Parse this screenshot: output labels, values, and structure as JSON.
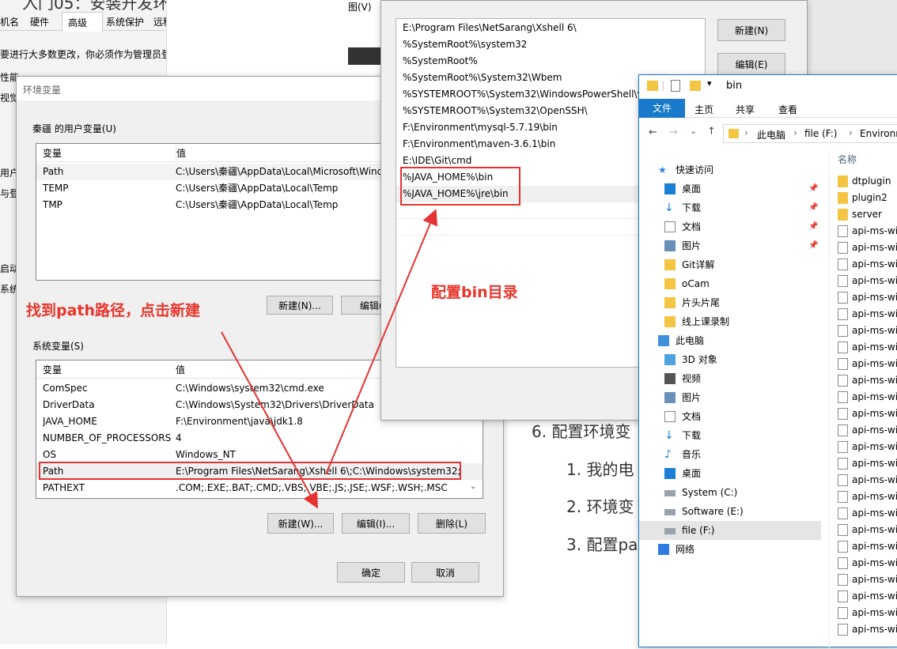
{
  "bg": {
    "title_fragment": "入门05：安装开发环境",
    "sys_tabs": [
      "机名",
      "硬件",
      "高级",
      "系统保护",
      "远程"
    ],
    "admin_note": "要进行大多数更改，你必须作为管理员登录。",
    "side_frags": [
      "性能",
      "视觉",
      "用户配",
      "与登",
      "启动",
      "系统"
    ],
    "menu_frag": "图(V)",
    "article": {
      "heading": "6. 配置环境变",
      "items": [
        "1. 我的电",
        "2. 环境变",
        "3. 配置pa"
      ]
    }
  },
  "env": {
    "title": "环境变量",
    "user_section": "秦疆 的用户变量(U)",
    "col_var": "变量",
    "col_val": "值",
    "user_vars": [
      {
        "name": "Path",
        "value": "C:\\Users\\秦疆\\AppData\\Local\\Microsoft\\Wind"
      },
      {
        "name": "TEMP",
        "value": "C:\\Users\\秦疆\\AppData\\Local\\Temp"
      },
      {
        "name": "TMP",
        "value": "C:\\Users\\秦疆\\AppData\\Local\\Temp"
      }
    ],
    "user_new": "新建(N)...",
    "user_edit": "编辑(E",
    "sys_section": "系统变量(S)",
    "sys_vars": [
      {
        "name": "ComSpec",
        "value": "C:\\Windows\\system32\\cmd.exe"
      },
      {
        "name": "DriverData",
        "value": "C:\\Windows\\System32\\Drivers\\DriverData"
      },
      {
        "name": "JAVA_HOME",
        "value": "F:\\Environment\\java\\jdk1.8"
      },
      {
        "name": "NUMBER_OF_PROCESSORS",
        "value": "4"
      },
      {
        "name": "OS",
        "value": "Windows_NT"
      },
      {
        "name": "Path",
        "value": "E:\\Program Files\\NetSarang\\Xshell 6\\;C:\\Windows\\system32;..."
      },
      {
        "name": "PATHEXT",
        "value": ".COM;.EXE;.BAT;.CMD;.VBS;.VBE;.JS;.JSE;.WSF;.WSH;.MSC"
      }
    ],
    "sys_new": "新建(W)...",
    "sys_edit": "编辑(I)...",
    "sys_delete": "删除(L)",
    "ok": "确定",
    "cancel": "取消"
  },
  "path_editor": {
    "entries": [
      "E:\\Program Files\\NetSarang\\Xshell 6\\",
      "%SystemRoot%\\system32",
      "%SystemRoot%",
      "%SystemRoot%\\System32\\Wbem",
      "%SYSTEMROOT%\\System32\\WindowsPowerShell\\v1",
      "%SYSTEMROOT%\\System32\\OpenSSH\\",
      "F:\\Environment\\mysql-5.7.19\\bin",
      "F:\\Environment\\maven-3.6.1\\bin",
      "E:\\IDE\\Git\\cmd",
      "%JAVA_HOME%\\bin",
      "%JAVA_HOME%\\jre\\bin"
    ],
    "new_btn": "新建(N)",
    "edit_btn": "编辑(E)"
  },
  "explorer": {
    "title": "bin",
    "ribbon_tabs": [
      "文件",
      "主页",
      "共享",
      "查看"
    ],
    "breadcrumb": [
      "此电脑",
      "file (F:)",
      "Environm"
    ],
    "column_header": "名称",
    "nav": [
      {
        "label": "快速访问",
        "icon": "star-icon",
        "pinned": false,
        "level": 0
      },
      {
        "label": "桌面",
        "icon": "desktop-icon",
        "pinned": true,
        "level": 1
      },
      {
        "label": "下载",
        "icon": "download-icon",
        "pinned": true,
        "level": 1
      },
      {
        "label": "文档",
        "icon": "document-icon",
        "pinned": true,
        "level": 1
      },
      {
        "label": "图片",
        "icon": "picture-icon",
        "pinned": true,
        "level": 1
      },
      {
        "label": "Git详解",
        "icon": "folder-icon",
        "pinned": false,
        "level": 1
      },
      {
        "label": "oCam",
        "icon": "folder-icon",
        "pinned": false,
        "level": 1
      },
      {
        "label": "片头片尾",
        "icon": "folder-icon",
        "pinned": false,
        "level": 1
      },
      {
        "label": "线上课录制",
        "icon": "folder-icon",
        "pinned": false,
        "level": 1
      },
      {
        "label": "此电脑",
        "icon": "computer-icon",
        "pinned": false,
        "level": 0
      },
      {
        "label": "3D 对象",
        "icon": "cube-icon",
        "pinned": false,
        "level": 1
      },
      {
        "label": "视频",
        "icon": "video-icon",
        "pinned": false,
        "level": 1
      },
      {
        "label": "图片",
        "icon": "picture-icon",
        "pinned": false,
        "level": 1
      },
      {
        "label": "文档",
        "icon": "document-icon",
        "pinned": false,
        "level": 1
      },
      {
        "label": "下载",
        "icon": "download-icon",
        "pinned": false,
        "level": 1
      },
      {
        "label": "音乐",
        "icon": "music-icon",
        "pinned": false,
        "level": 1
      },
      {
        "label": "桌面",
        "icon": "desktop-icon",
        "pinned": false,
        "level": 1
      },
      {
        "label": "System (C:)",
        "icon": "drive-icon",
        "pinned": false,
        "level": 1
      },
      {
        "label": "Software (E:)",
        "icon": "drive-icon",
        "pinned": false,
        "level": 1
      },
      {
        "label": "file (F:)",
        "icon": "drive-icon",
        "pinned": false,
        "level": 1
      },
      {
        "label": "网络",
        "icon": "network-icon",
        "pinned": false,
        "level": 0
      }
    ],
    "files": [
      "dtplugin",
      "plugin2",
      "server",
      "api-ms-wi",
      "api-ms-wi",
      "api-ms-wi",
      "api-ms-wi",
      "api-ms-wi",
      "api-ms-wi",
      "api-ms-wi",
      "api-ms-wi",
      "api-ms-wi",
      "api-ms-wi",
      "api-ms-wi",
      "api-ms-wi",
      "api-ms-wi",
      "api-ms-wi",
      "api-ms-wi",
      "api-ms-wi",
      "api-ms-wi",
      "api-ms-wi",
      "api-ms-wi",
      "api-ms-wi",
      "api-ms-wi",
      "api-ms-wi",
      "api-ms-wi",
      "api-ms-wi",
      "api-ms-wi"
    ]
  },
  "annotations": {
    "find_path": "找到path路径，点击新建",
    "config_bin": "配置bin目录"
  },
  "colors": {
    "annotation_red": "#e53333",
    "ribbon_blue": "#1979ca",
    "selection_blue": "#cce8ff",
    "folder_yellow": "#f4c542"
  }
}
